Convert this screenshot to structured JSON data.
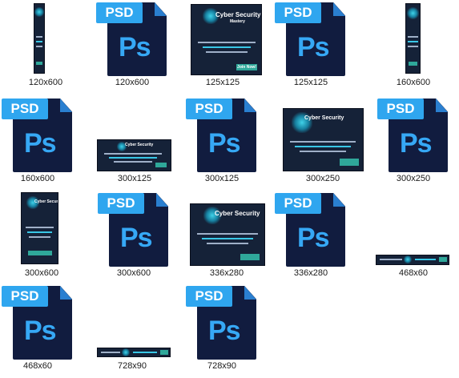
{
  "files": [
    {
      "label": "120x600",
      "kind": "banner"
    },
    {
      "label": "120x600",
      "kind": "psd"
    },
    {
      "label": "125x125",
      "kind": "banner"
    },
    {
      "label": "125x125",
      "kind": "psd"
    },
    {
      "label": "160x600",
      "kind": "banner"
    },
    {
      "label": "160x600",
      "kind": "psd"
    },
    {
      "label": "300x125",
      "kind": "banner"
    },
    {
      "label": "300x125",
      "kind": "psd"
    },
    {
      "label": "300x250",
      "kind": "banner"
    },
    {
      "label": "300x250",
      "kind": "psd"
    },
    {
      "label": "300x600",
      "kind": "banner"
    },
    {
      "label": "300x600",
      "kind": "psd"
    },
    {
      "label": "336x280",
      "kind": "banner"
    },
    {
      "label": "336x280",
      "kind": "psd"
    },
    {
      "label": "468x60",
      "kind": "banner"
    },
    {
      "label": "468x60",
      "kind": "psd"
    },
    {
      "label": "728x90",
      "kind": "banner"
    },
    {
      "label": "728x90",
      "kind": "psd"
    }
  ],
  "psd_icon": {
    "tag": "PSD",
    "glyph": "Ps"
  },
  "banner_text": {
    "brand": "Cyber Security",
    "brand_sub": "Mastery",
    "headline": "Find the Latest Information and Methods of",
    "highlight": "Cyber Security to Protect",
    "tail": "your Online Business",
    "cta": "Join Now!"
  },
  "colors": {
    "psd_page": "#111c3f",
    "psd_tag": "#2fa6ef",
    "ps_glyph": "#36a8f5",
    "banner_bg": "#152238",
    "banner_accent": "#39c7e6",
    "cta": "#2fa89a"
  }
}
